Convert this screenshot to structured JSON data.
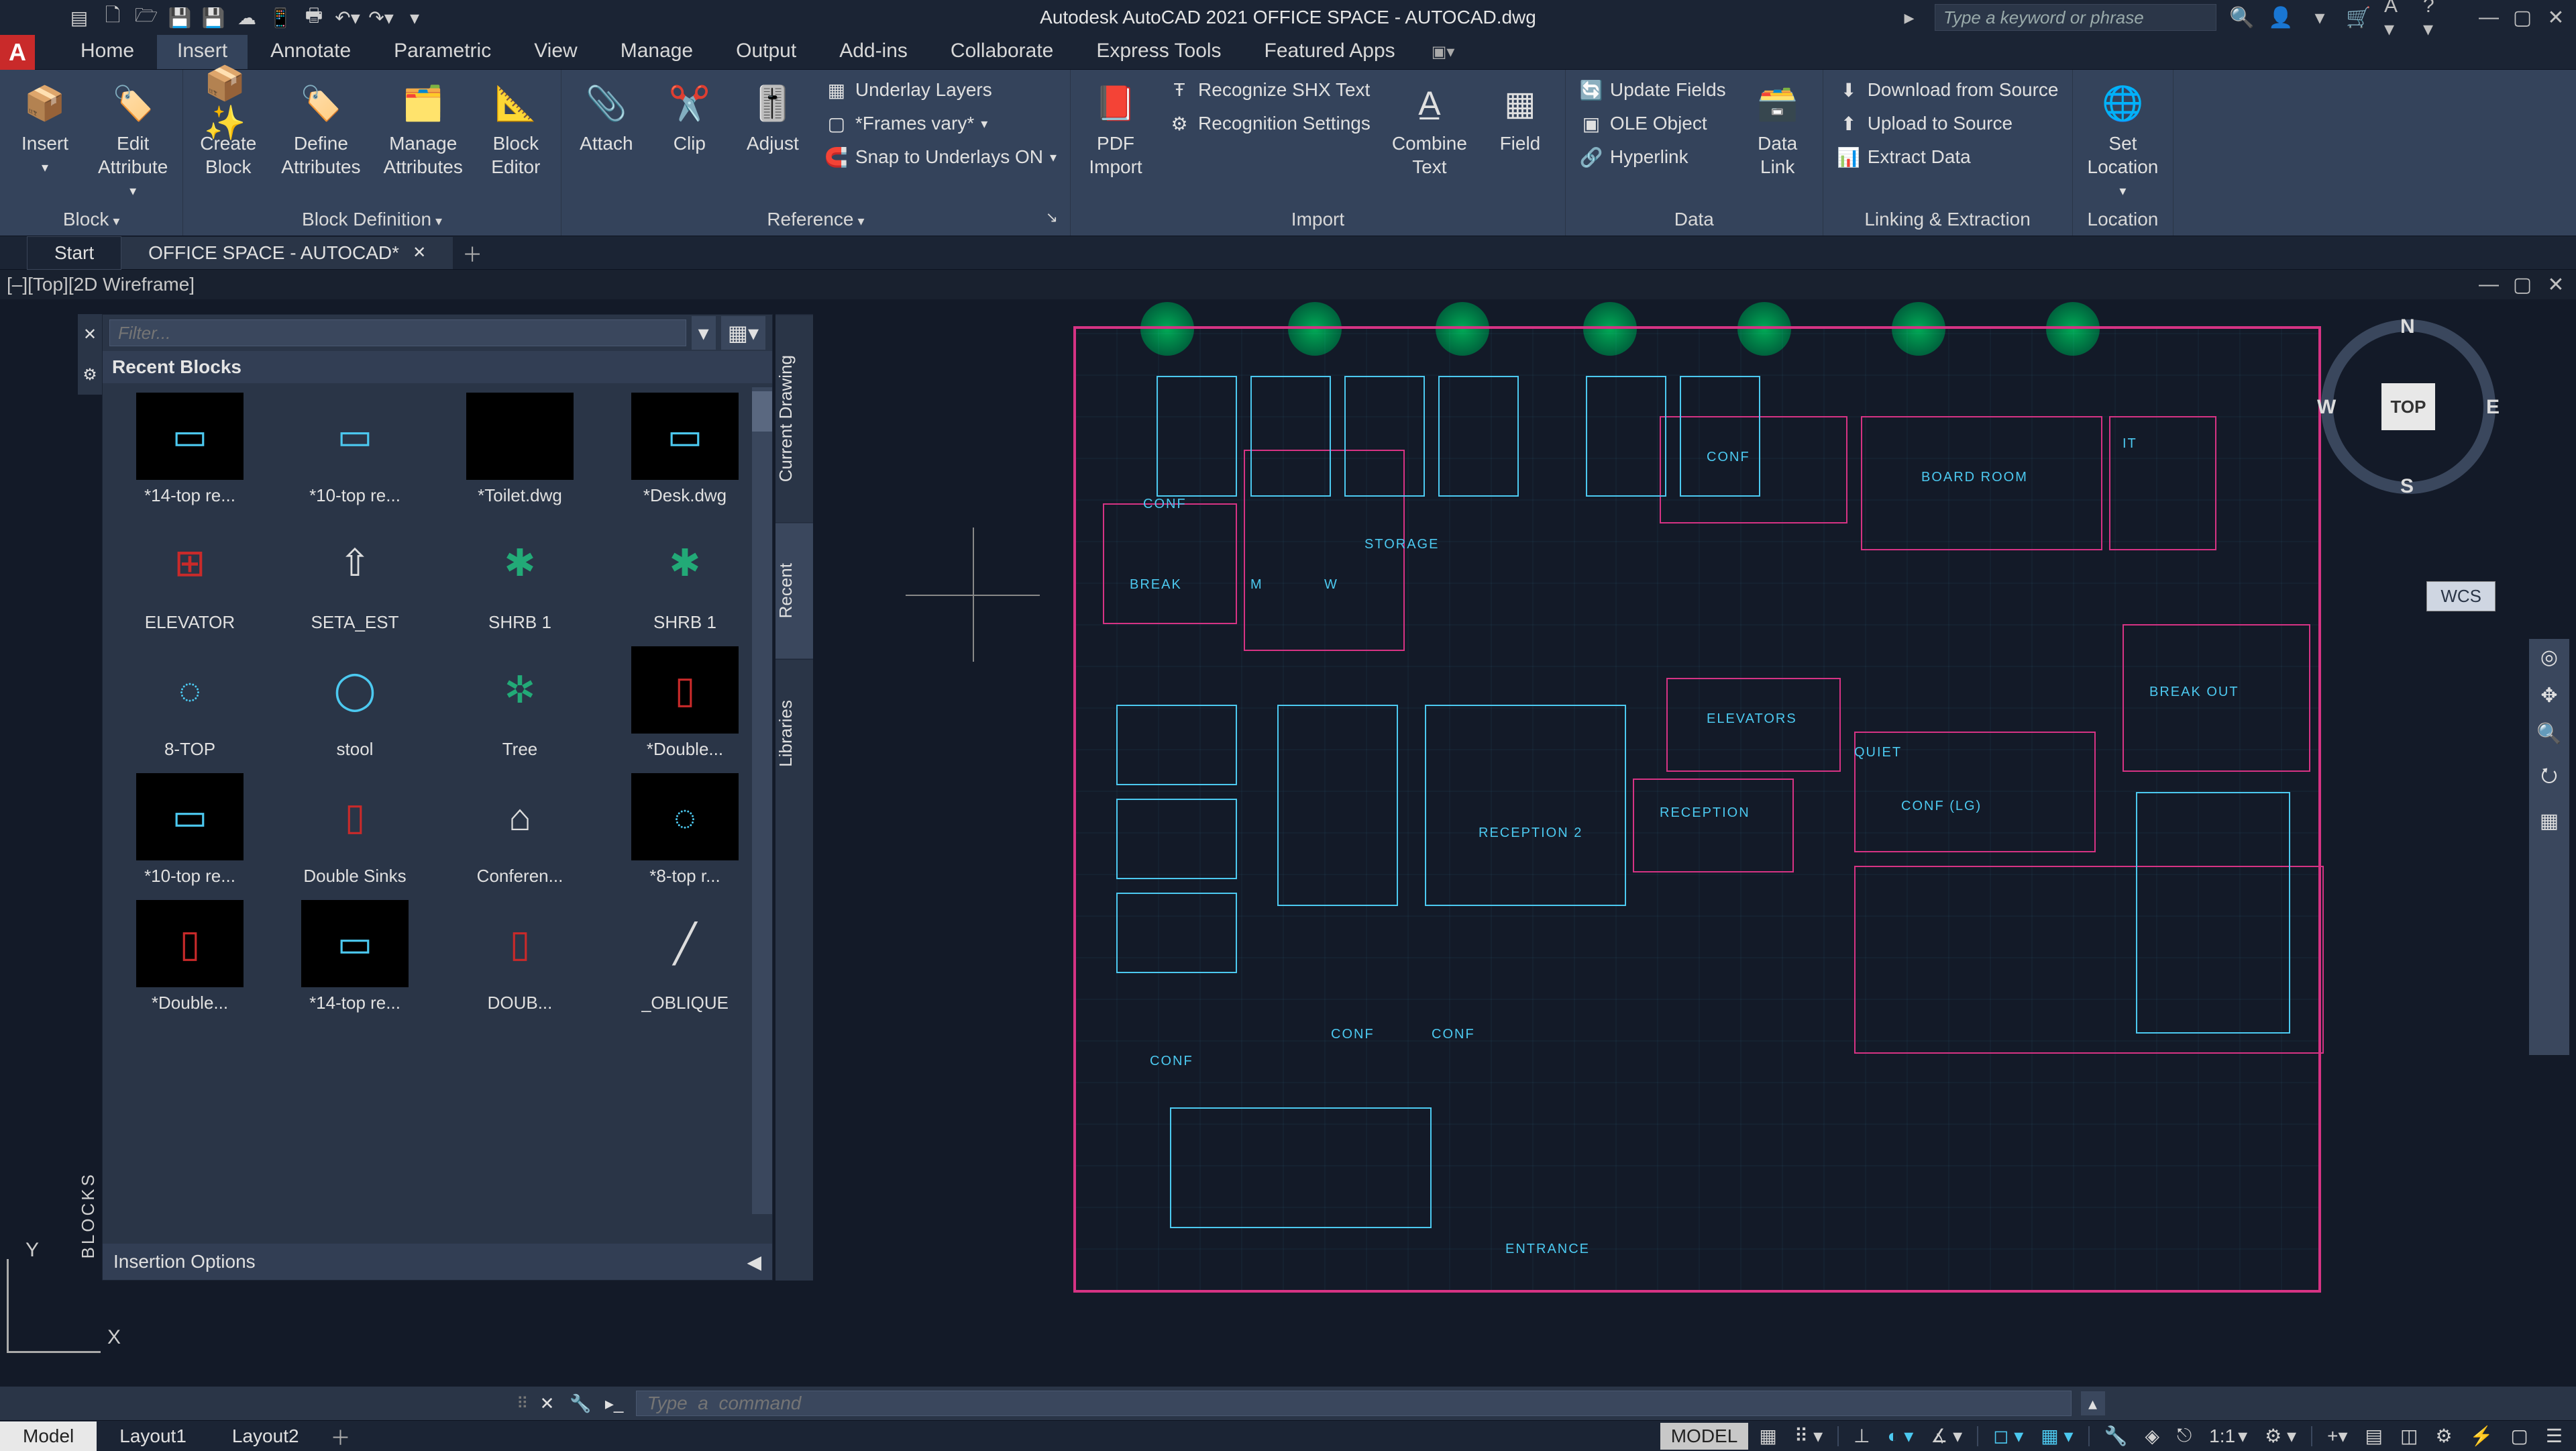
{
  "app": {
    "title": "Autodesk AutoCAD 2021   OFFICE SPACE - AUTOCAD.dwg",
    "search_placeholder": "Type a keyword or phrase"
  },
  "tabs": {
    "items": [
      "Home",
      "Insert",
      "Annotate",
      "Parametric",
      "View",
      "Manage",
      "Output",
      "Add-ins",
      "Collaborate",
      "Express Tools",
      "Featured Apps"
    ],
    "active": "Insert"
  },
  "ribbon": {
    "block": {
      "title": "Block",
      "insert": "Insert",
      "edit_attribute": "Edit\nAttribute"
    },
    "block_def": {
      "title": "Block Definition",
      "create": "Create\nBlock",
      "define": "Define\nAttributes",
      "manage": "Manage\nAttributes",
      "editor": "Block\nEditor"
    },
    "reference": {
      "title": "Reference",
      "attach": "Attach",
      "clip": "Clip",
      "adjust": "Adjust",
      "underlay": "Underlay Layers",
      "frames": "*Frames vary*",
      "snap": "Snap to Underlays ON"
    },
    "import": {
      "title": "Import",
      "pdf": "PDF\nImport",
      "shx": "Recognize SHX Text",
      "settings": "Recognition Settings",
      "combine": "Combine\nText",
      "field": "Field"
    },
    "data": {
      "title": "Data",
      "update": "Update Fields",
      "ole": "OLE Object",
      "hyper": "Hyperlink",
      "link": "Data\nLink"
    },
    "linking": {
      "title": "Linking & Extraction",
      "down": "Download from Source",
      "up": "Upload to Source",
      "extract": "Extract  Data"
    },
    "location": {
      "title": "Location",
      "set": "Set\nLocation"
    }
  },
  "file_tabs": {
    "start": "Start",
    "doc": "OFFICE SPACE - AUTOCAD*"
  },
  "vp_label": "[–][Top][2D Wireframe]",
  "blocks_panel": {
    "filter_placeholder": "Filter...",
    "title": "Recent Blocks",
    "side_label": "BLOCKS",
    "vtabs": [
      "Current Drawing",
      "Recent",
      "Libraries"
    ],
    "footer": "Insertion Options",
    "items": [
      {
        "label": "*14-top re...",
        "bg": "dark",
        "glyph": "▭",
        "color": "#4cc9f0"
      },
      {
        "label": "*10-top re...",
        "bg": "light",
        "glyph": "▭",
        "color": "#4cc9f0"
      },
      {
        "label": "*Toilet.dwg",
        "bg": "dark",
        "glyph": " ",
        "color": "#888"
      },
      {
        "label": "*Desk.dwg",
        "bg": "dark",
        "glyph": "▭",
        "color": "#4cc9f0"
      },
      {
        "label": "ELEVATOR",
        "bg": "light",
        "glyph": "⊞",
        "color": "#c92a2a"
      },
      {
        "label": "SETA_EST",
        "bg": "light",
        "glyph": "⇧",
        "color": "#ddd"
      },
      {
        "label": "SHRB 1",
        "bg": "light",
        "glyph": "✱",
        "color": "#2a7"
      },
      {
        "label": "SHRB 1",
        "bg": "light",
        "glyph": "✱",
        "color": "#2a7"
      },
      {
        "label": "8-TOP",
        "bg": "light",
        "glyph": "◌",
        "color": "#4cc9f0"
      },
      {
        "label": "stool",
        "bg": "light",
        "glyph": "◯",
        "color": "#4cc9f0"
      },
      {
        "label": "Tree",
        "bg": "light",
        "glyph": "✲",
        "color": "#2a7"
      },
      {
        "label": "*Double...",
        "bg": "dark",
        "glyph": "▯",
        "color": "#c92a2a"
      },
      {
        "label": "*10-top re...",
        "bg": "dark",
        "glyph": "▭",
        "color": "#4cc9f0"
      },
      {
        "label": "Double Sinks",
        "bg": "light",
        "glyph": "▯",
        "color": "#c92a2a"
      },
      {
        "label": "Conferen...",
        "bg": "light",
        "glyph": "⌂",
        "color": "#ddd"
      },
      {
        "label": "*8-top r...",
        "bg": "dark",
        "glyph": "◌",
        "color": "#4cc9f0"
      },
      {
        "label": "*Double...",
        "bg": "dark",
        "glyph": "▯",
        "color": "#c92a2a"
      },
      {
        "label": "*14-top re...",
        "bg": "dark",
        "glyph": "▭",
        "color": "#4cc9f0"
      },
      {
        "label": "DOUB...",
        "bg": "light",
        "glyph": "▯",
        "color": "#c92a2a"
      },
      {
        "label": "_OBLIQUE",
        "bg": "light",
        "glyph": "╱",
        "color": "#ddd"
      }
    ]
  },
  "viewcube": {
    "top": "TOP",
    "n": "N",
    "s": "S",
    "e": "E",
    "w": "W",
    "wcs": "WCS"
  },
  "floorplan_labels": {
    "storage": "STORAGE",
    "break": "BREAK",
    "m": "M",
    "w": "W",
    "elevators": "ELEVATORS",
    "reception": "RECEPTION",
    "reception2": "RECEPTION 2",
    "conf": "CONF",
    "conf_lg": "CONF  (LG)",
    "board": "BOARD ROOM",
    "quiet": "QUIET",
    "entrance": "ENTRANCE",
    "breakout": "BREAK  OUT",
    "it": "IT"
  },
  "cmd": {
    "placeholder": "Type  a  command"
  },
  "layout_tabs": [
    "Model",
    "Layout1",
    "Layout2"
  ],
  "status": {
    "model": "MODEL",
    "scale": "1:1"
  }
}
